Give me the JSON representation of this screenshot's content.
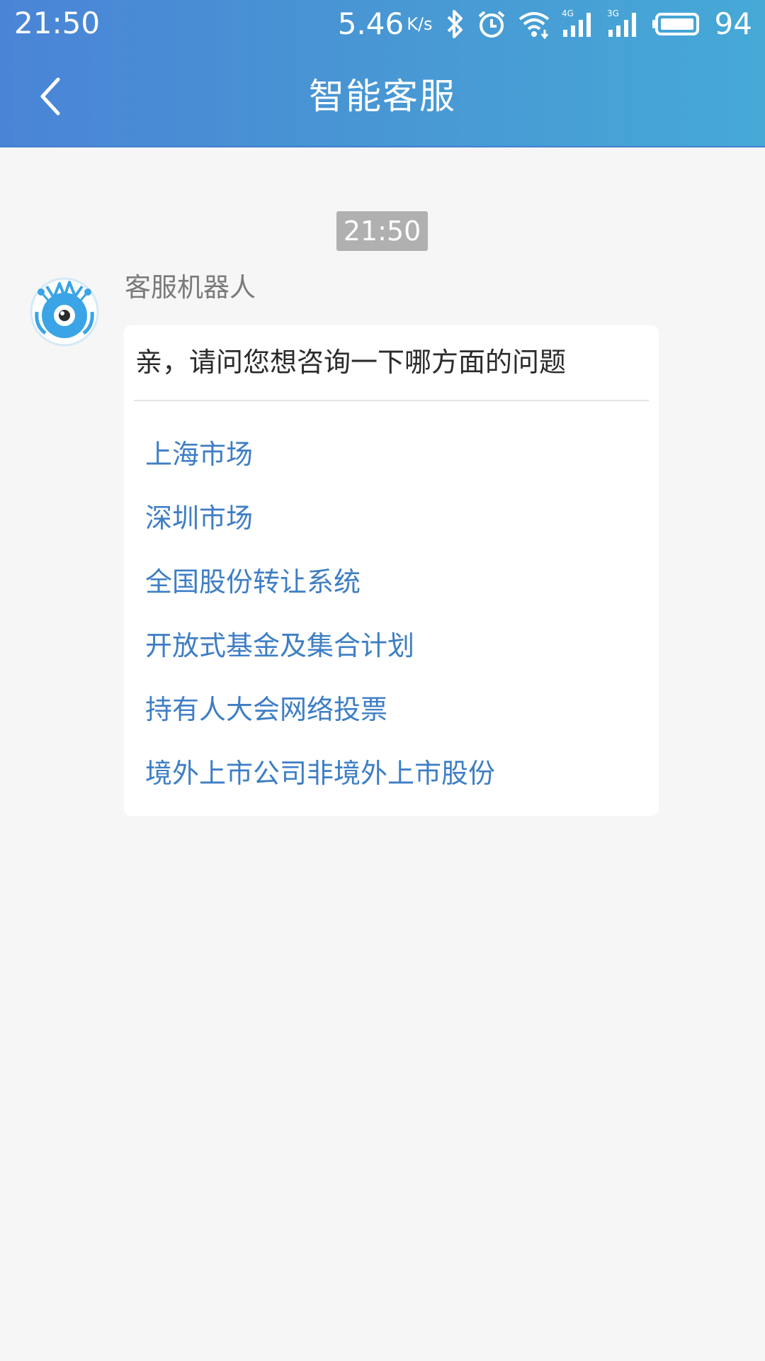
{
  "status_bar": {
    "time": "21:50",
    "net_speed": "5.46",
    "net_speed_unit": "K/s",
    "battery_pct": "94",
    "icons": [
      "bluetooth-icon",
      "alarm-icon",
      "wifi-icon",
      "signal-4g-icon",
      "signal-3g-icon",
      "battery-icon"
    ]
  },
  "nav": {
    "title": "智能客服",
    "back_icon": "chevron-left-icon"
  },
  "chat": {
    "timestamp": "21:50",
    "sender_name": "客服机器人",
    "avatar_icon": "robot-avatar-icon",
    "question": "亲，请问您想咨询一下哪方面的问题",
    "options": [
      "上海市场",
      "深圳市场",
      "全国股份转让系统",
      "开放式基金及集合计划",
      "持有人大会网络投票",
      "境外上市公司非境外上市股份"
    ]
  },
  "colors": {
    "header_start": "#4a84d6",
    "header_end": "#46a9d6",
    "page_bg": "#f6f6f6",
    "option_link": "#3e7ec4",
    "timestamp_bg": "#b0b0b0"
  }
}
